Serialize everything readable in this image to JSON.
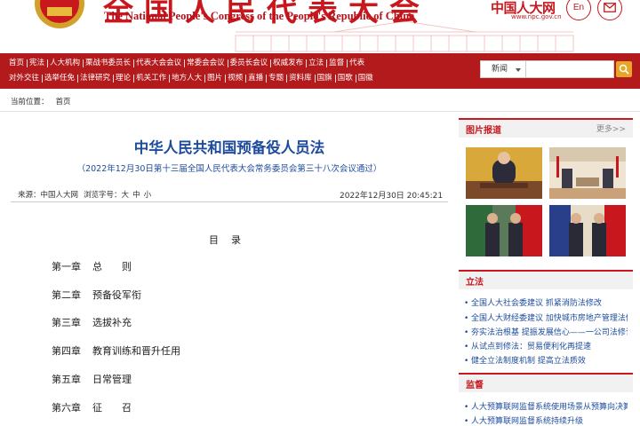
{
  "header": {
    "title_cn": "全国人民代表大会",
    "title_en": "The National People's Congress of the People's Republic of China",
    "logo_cn": "中国人大网",
    "logo_url": "www.npc.gov.cn",
    "lang_button": "En"
  },
  "nav": {
    "row1": [
      "首页",
      "宪法",
      "人大机构",
      "栗战书委员长",
      "代表大会会议",
      "常委会会议",
      "委员长会议",
      "权威发布",
      "立法",
      "监督",
      "代表"
    ],
    "row2": [
      "对外交往",
      "选举任免",
      "法律研究",
      "理论",
      "机关工作",
      "地方人大",
      "图片",
      "视频",
      "直播",
      "专题",
      "资料库",
      "国旗",
      "国歌",
      "国徽"
    ]
  },
  "search": {
    "selected": "新闻",
    "placeholder": ""
  },
  "breadcrumb": {
    "label": "当前位置：",
    "home": "首页"
  },
  "article": {
    "title": "中华人民共和国预备役人员法",
    "subtitle": "（2022年12月30日第十三届全国人民代表大会常务委员会第三十八次会议通过）",
    "source_label": "来源：",
    "source": "中国人大网",
    "fontsize_label": "浏览字号：",
    "size_large": "大",
    "size_medium": "中",
    "size_small": "小",
    "datetime": "2022年12月30日 20:45:21",
    "toc_title": "目录",
    "toc": [
      {
        "num": "第一章",
        "title": "总　　则"
      },
      {
        "num": "第二章",
        "title": "预备役军衔"
      },
      {
        "num": "第三章",
        "title": "选拔补充"
      },
      {
        "num": "第四章",
        "title": "教育训练和晋升任用"
      },
      {
        "num": "第五章",
        "title": "日常管理"
      },
      {
        "num": "第六章",
        "title": "征　　召"
      }
    ]
  },
  "sidebar": {
    "photo_panel": {
      "label": "图片报道",
      "more": "更多>>"
    },
    "legislation_panel": {
      "label": "立法",
      "items": [
        "全国人大社会委建议 抓紧消防法修改",
        "全国人大财经委建议 加快城市房地产管理法修改",
        "夯实法治根基 提振发展信心——一公司法修订",
        "从试点到修法：贸易便利化再提速",
        "健全立法制度机制 提高立法质效"
      ]
    },
    "supervision_panel": {
      "label": "监督",
      "items": [
        "人大预算联网监督系统使用场景从预算向决算拓展",
        "人大预算联网监督系统持续升级"
      ]
    }
  },
  "colors": {
    "brand_red": "#c8181e",
    "nav_red": "#b31a1c",
    "link_blue": "#1d4c9e"
  }
}
